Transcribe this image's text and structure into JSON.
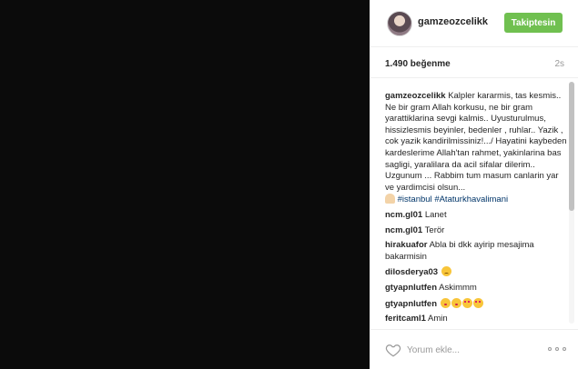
{
  "header": {
    "username": "gamzeozcelikk",
    "follow_label": "Takiptesin"
  },
  "meta": {
    "likes": "1.490 beğenme",
    "time": "2s"
  },
  "caption": {
    "username": "gamzeozcelikk",
    "text": "Kalpler kararmis, tas kesmis.. Ne bir gram Allah korkusu, ne bir gram yarattiklarina sevgi kalmis.. Uyusturulmus, hissizlesmis beyinler, bedenler , ruhlar.. Yazik , cok yazik kandirilmissiniz!.../ Hayatini kaybeden kardeslerime Allah'tan rahmet, yakinlarina bas sagligi, yaralilara da acil sifalar dilerim.. Uzgunum ... Rabbim tum masum canlarin yar ve yardimcisi olsun...",
    "hashtag1": "#istanbul",
    "hashtag2": "#Ataturkhavalimani"
  },
  "comments": [
    {
      "username": "ncm.gl01",
      "text": "Lanet"
    },
    {
      "username": "ncm.gl01",
      "text": "Terör"
    },
    {
      "username": "hirakuafor",
      "text": "Abla bi dkk ayirip mesajima bakarmisin"
    },
    {
      "username": "dilosderya03",
      "text": ""
    },
    {
      "username": "gtyapnlutfen",
      "text": "Askimmm"
    },
    {
      "username": "gtyapnlutfen",
      "text": ""
    },
    {
      "username": "feritcaml1",
      "text": "Amin"
    }
  ],
  "footer": {
    "comment_placeholder": "Yorum ekle..."
  },
  "icons": {
    "heart": "heart-outline-icon",
    "more": "more-options-icon",
    "pray": "praying-hands-emoji",
    "sad": "sad-face-emoji",
    "kiss": "kissing-face-emoji",
    "hearteyes": "heart-eyes-emoji"
  },
  "colors": {
    "follow_button": "#70c050",
    "hashtag": "#003569",
    "media_background": "#0b0b0b"
  }
}
